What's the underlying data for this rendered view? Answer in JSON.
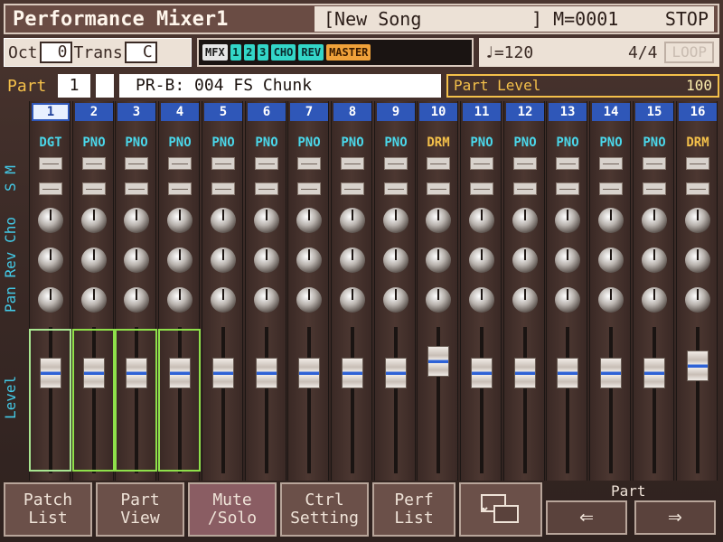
{
  "header": {
    "title": "Performance Mixer1",
    "song": "[New Song",
    "measure": "] M=0001",
    "status": "STOP"
  },
  "controls": {
    "oct_label": "Oct",
    "oct_value": "0",
    "trans_label": "Trans",
    "trans_value": "C",
    "fx": [
      "MFX",
      "1",
      "2",
      "3",
      "CHO",
      "REV",
      "MASTER"
    ],
    "tempo": "♩=120",
    "time_sig": "4/4",
    "loop": "LOOP"
  },
  "part": {
    "label": "Part",
    "number": "1",
    "patch": "PR-B: 004 FS Chunk",
    "level_label": "Part Level",
    "level_value": "100"
  },
  "side_labels": {
    "s_m": "S M",
    "pan_rev_cho": "Pan Rev Cho",
    "level": "Level"
  },
  "channels": [
    {
      "num": "1",
      "tone": "DGT",
      "level": 0.78
    },
    {
      "num": "2",
      "tone": "PNO",
      "level": 0.78
    },
    {
      "num": "3",
      "tone": "PNO",
      "level": 0.78
    },
    {
      "num": "4",
      "tone": "PNO",
      "level": 0.78
    },
    {
      "num": "5",
      "tone": "PNO",
      "level": 0.78
    },
    {
      "num": "6",
      "tone": "PNO",
      "level": 0.78
    },
    {
      "num": "7",
      "tone": "PNO",
      "level": 0.78
    },
    {
      "num": "8",
      "tone": "PNO",
      "level": 0.78
    },
    {
      "num": "9",
      "tone": "PNO",
      "level": 0.78
    },
    {
      "num": "10",
      "tone": "DRM",
      "level": 0.88
    },
    {
      "num": "11",
      "tone": "PNO",
      "level": 0.78
    },
    {
      "num": "12",
      "tone": "PNO",
      "level": 0.78
    },
    {
      "num": "13",
      "tone": "PNO",
      "level": 0.78
    },
    {
      "num": "14",
      "tone": "PNO",
      "level": 0.78
    },
    {
      "num": "15",
      "tone": "PNO",
      "level": 0.78
    },
    {
      "num": "16",
      "tone": "DRM",
      "level": 0.84
    }
  ],
  "buttons": {
    "patch_list": [
      "Patch",
      "List"
    ],
    "part_view": [
      "Part",
      "View"
    ],
    "mute_solo": [
      "Mute",
      "/Solo"
    ],
    "ctrl_setting": [
      "Ctrl",
      "Setting"
    ],
    "perf_list": [
      "Perf",
      "List"
    ],
    "part_nav": "Part",
    "prev": "⇐",
    "next": "⇒"
  }
}
